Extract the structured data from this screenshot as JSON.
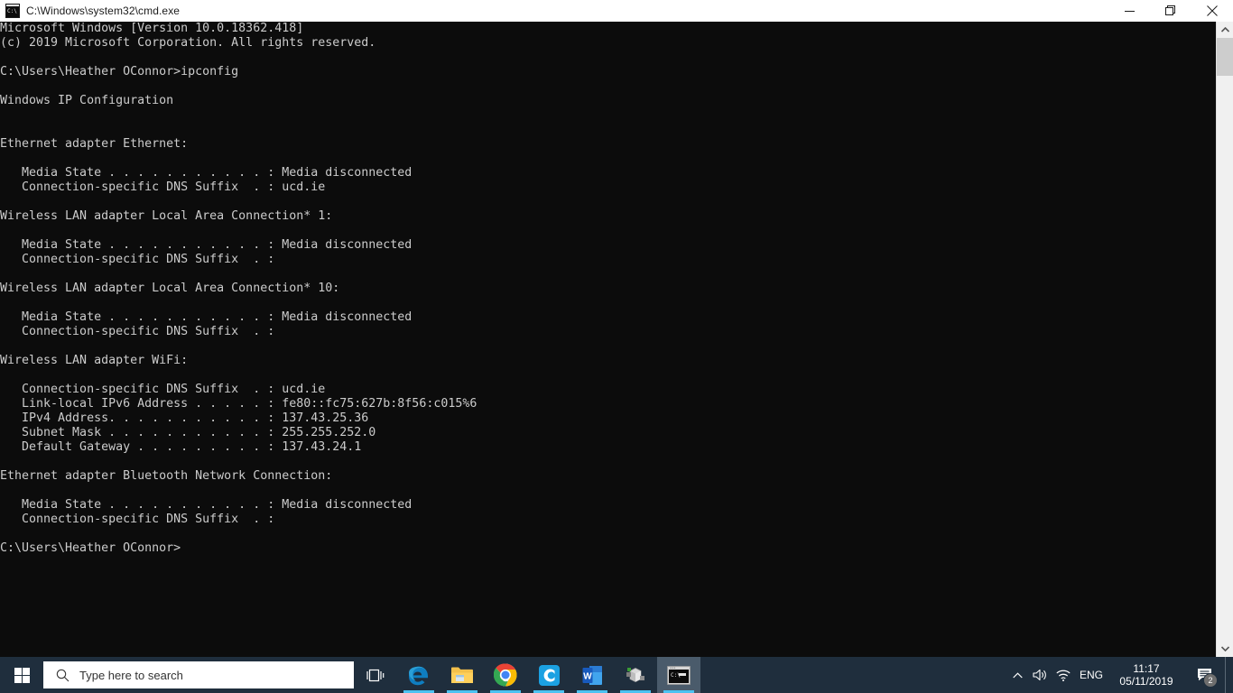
{
  "window": {
    "title": "C:\\Windows\\system32\\cmd.exe",
    "icon": "cmd-icon",
    "icon_text": "C:\\",
    "controls": {
      "minimize": "Minimize",
      "restore": "Restore",
      "close": "Close"
    }
  },
  "console": {
    "background": "#0c0c0c",
    "foreground": "#cccccc",
    "text": "Microsoft Windows [Version 10.0.18362.418]\n(c) 2019 Microsoft Corporation. All rights reserved.\n\nC:\\Users\\Heather OConnor>ipconfig\n\nWindows IP Configuration\n\n\nEthernet adapter Ethernet:\n\n   Media State . . . . . . . . . . . : Media disconnected\n   Connection-specific DNS Suffix  . : ucd.ie\n\nWireless LAN adapter Local Area Connection* 1:\n\n   Media State . . . . . . . . . . . : Media disconnected\n   Connection-specific DNS Suffix  . :\n\nWireless LAN adapter Local Area Connection* 10:\n\n   Media State . . . . . . . . . . . : Media disconnected\n   Connection-specific DNS Suffix  . :\n\nWireless LAN adapter WiFi:\n\n   Connection-specific DNS Suffix  . : ucd.ie\n   Link-local IPv6 Address . . . . . : fe80::fc75:627b:8f56:c015%6\n   IPv4 Address. . . . . . . . . . . : 137.43.25.36\n   Subnet Mask . . . . . . . . . . . : 255.255.252.0\n   Default Gateway . . . . . . . . . : 137.43.24.1\n\nEthernet adapter Bluetooth Network Connection:\n\n   Media State . . . . . . . . . . . : Media disconnected\n   Connection-specific DNS Suffix  . :\n\nC:\\Users\\Heather OConnor>",
    "command": "ipconfig",
    "prompt": "C:\\Users\\Heather OConnor>",
    "version_line": "Microsoft Windows [Version 10.0.18362.418]",
    "copyright_line": "(c) 2019 Microsoft Corporation. All rights reserved.",
    "adapters": [
      {
        "name": "Ethernet adapter Ethernet:",
        "fields": [
          {
            "label": "Media State . . . . . . . . . . . :",
            "value": "Media disconnected"
          },
          {
            "label": "Connection-specific DNS Suffix  . :",
            "value": "ucd.ie"
          }
        ]
      },
      {
        "name": "Wireless LAN adapter Local Area Connection* 1:",
        "fields": [
          {
            "label": "Media State . . . . . . . . . . . :",
            "value": "Media disconnected"
          },
          {
            "label": "Connection-specific DNS Suffix  . :",
            "value": ""
          }
        ]
      },
      {
        "name": "Wireless LAN adapter Local Area Connection* 10:",
        "fields": [
          {
            "label": "Media State . . . . . . . . . . . :",
            "value": "Media disconnected"
          },
          {
            "label": "Connection-specific DNS Suffix  . :",
            "value": ""
          }
        ]
      },
      {
        "name": "Wireless LAN adapter WiFi:",
        "fields": [
          {
            "label": "Connection-specific DNS Suffix  . :",
            "value": "ucd.ie"
          },
          {
            "label": "Link-local IPv6 Address . . . . . :",
            "value": "fe80::fc75:627b:8f56:c015%6"
          },
          {
            "label": "IPv4 Address. . . . . . . . . . . :",
            "value": "137.43.25.36"
          },
          {
            "label": "Subnet Mask . . . . . . . . . . . :",
            "value": "255.255.252.0"
          },
          {
            "label": "Default Gateway . . . . . . . . . :",
            "value": "137.43.24.1"
          }
        ]
      },
      {
        "name": "Ethernet adapter Bluetooth Network Connection:",
        "fields": [
          {
            "label": "Media State . . . . . . . . . . . :",
            "value": "Media disconnected"
          },
          {
            "label": "Connection-specific DNS Suffix  . :",
            "value": ""
          }
        ]
      }
    ]
  },
  "scrollbar": {
    "up_arrow": "chevron-up-icon",
    "down_arrow": "chevron-down-icon"
  },
  "taskbar": {
    "background": "#1f2e3d",
    "start": "start-button",
    "search": {
      "placeholder": "Type here to search",
      "icon": "search-icon"
    },
    "items": [
      {
        "name": "task-view",
        "label": "Task View",
        "running": false
      },
      {
        "name": "microsoft-edge",
        "label": "Microsoft Edge",
        "running": true
      },
      {
        "name": "file-explorer",
        "label": "File Explorer",
        "running": true
      },
      {
        "name": "google-chrome",
        "label": "Google Chrome",
        "running": true
      },
      {
        "name": "cisco-app",
        "label": "Cisco",
        "running": true
      },
      {
        "name": "microsoft-word",
        "label": "Microsoft Word",
        "running": true
      },
      {
        "name": "3d-builder",
        "label": "3D Builder",
        "running": true
      },
      {
        "name": "command-prompt",
        "label": "Command Prompt",
        "running": true,
        "active": true
      }
    ],
    "tray": {
      "chevron": "chevron-up-icon",
      "volume": "speaker-icon",
      "network": "wifi-icon",
      "language": "ENG",
      "time": "11:17",
      "date": "05/11/2019",
      "notifications_count": "2"
    }
  }
}
